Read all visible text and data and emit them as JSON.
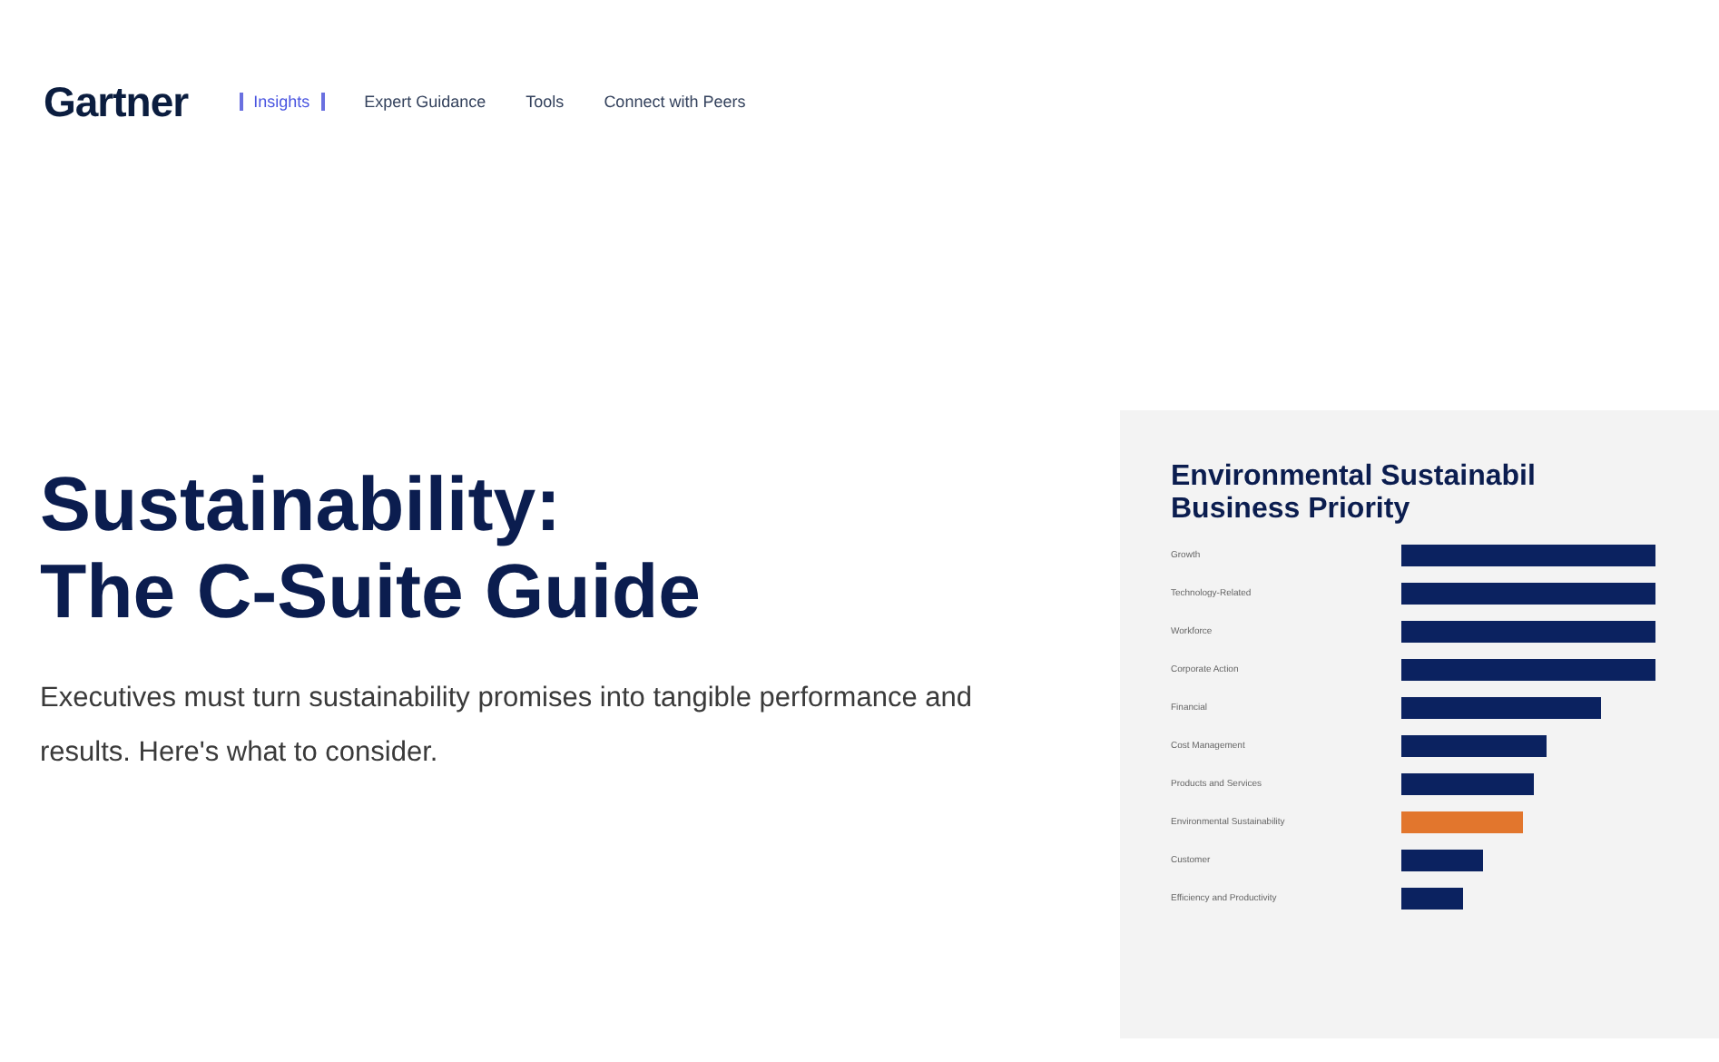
{
  "header": {
    "logo": "Gartner",
    "nav": [
      {
        "label": "Insights",
        "selected": true
      },
      {
        "label": "Expert Guidance",
        "selected": false
      },
      {
        "label": "Tools",
        "selected": false
      },
      {
        "label": "Connect with Peers",
        "selected": false
      }
    ]
  },
  "hero": {
    "title_lines": [
      "Sustainability:",
      "The C-Suite Guide"
    ],
    "description": "Executives must turn sustainability promises into tangible performance and results. Here's what to consider."
  },
  "chart_card": {
    "title_lines": [
      "Environmental Sustainabil",
      "Business Priority"
    ],
    "bars": [
      {
        "label": "Growth",
        "color": "#0b2260"
      },
      {
        "label": "Technology-Related",
        "color": "#0b2260"
      },
      {
        "label": "Workforce",
        "color": "#0b2260"
      },
      {
        "label": "Corporate Action",
        "color": "#0b2260"
      },
      {
        "label": "Financial",
        "color": "#0b2260"
      },
      {
        "label": "Cost Management",
        "color": "#0b2260"
      },
      {
        "label": "Products and Services",
        "color": "#0b2260"
      },
      {
        "label": "Environmental Sustainability",
        "color": "#e2762d"
      },
      {
        "label": "Customer",
        "color": "#0b2260"
      },
      {
        "label": "Efficiency and Productivity",
        "color": "#0b2260"
      }
    ]
  }
}
